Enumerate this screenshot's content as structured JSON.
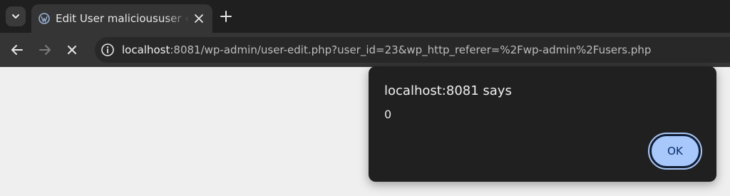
{
  "browser": {
    "tab": {
      "title": "Edit User malicioususer ‹",
      "favicon": "wordpress-icon"
    },
    "toolbar": {
      "back_icon": "arrow-left-icon",
      "forward_icon": "arrow-right-icon",
      "stop_icon": "close-icon"
    },
    "address": {
      "host": "localhost",
      "rest": ":8081/wp-admin/user-edit.php?user_id=23&wp_http_referer=%2Fwp-admin%2Fusers.php"
    }
  },
  "dialog": {
    "title": "localhost:8081 says",
    "message": "0",
    "ok_label": "OK"
  },
  "colors": {
    "frame": "#1f1f1f",
    "toolbar": "#353535",
    "dialog_bg": "#202020",
    "ok_button": "#a8c7fa",
    "page_bg": "#efefef"
  }
}
